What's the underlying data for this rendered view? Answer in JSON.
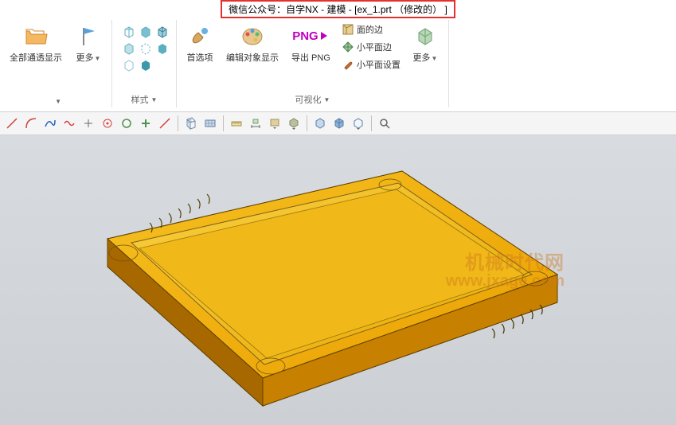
{
  "titlebar": {
    "text": "微信公众号：自学NX - 建模 - [ex_1.prt （修改的） ]"
  },
  "ribbon": {
    "group1": {
      "btn1": "全部通透显示",
      "btn2": "更多"
    },
    "group2": {
      "label": "样式"
    },
    "group3": {
      "btn1": "首选项",
      "btn2": "编辑对象显示",
      "btn3": "导出 PNG",
      "png": "PNG",
      "opt1": "面的边",
      "opt2": "小平面边",
      "opt3": "小平面设置",
      "btn5": "更多",
      "label": "可视化"
    }
  },
  "watermark": {
    "line1": "机械时代网",
    "line2": "www.jxage.com"
  }
}
